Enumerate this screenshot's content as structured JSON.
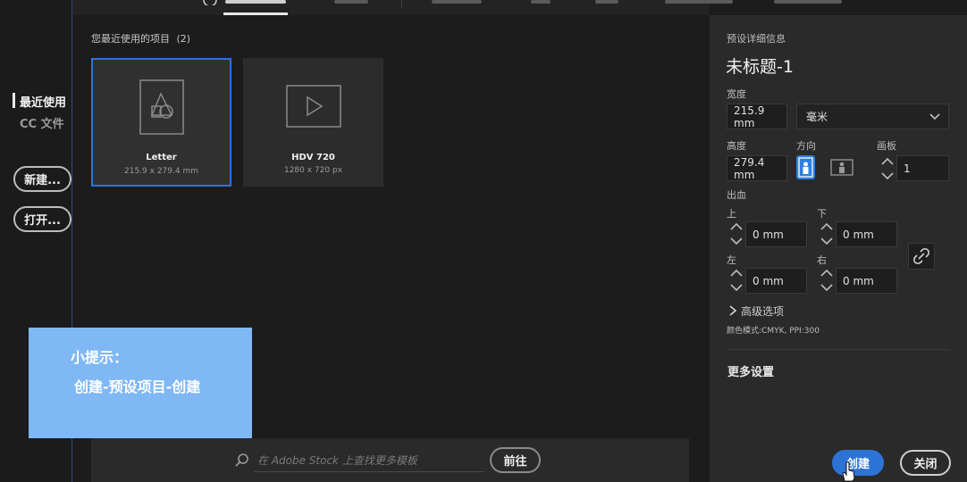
{
  "nav": {
    "recent": "最近使用",
    "cc_files": "CC 文件",
    "new_button": "新建...",
    "open_button": "打开..."
  },
  "recent": {
    "title": "您最近使用的项目",
    "count": "(2)",
    "presets": [
      {
        "name": "Letter",
        "size": "215.9 x 279.4 mm"
      },
      {
        "name": "HDV 720",
        "size": "1280 x 720 px"
      }
    ]
  },
  "search": {
    "placeholder": "在 Adobe Stock 上查找更多模板",
    "go_button": "前往"
  },
  "tip": {
    "line1": "小提示：",
    "line2": "创建-预设项目-创建"
  },
  "details": {
    "header": "预设详细信息",
    "doc_name": "未标题-1",
    "width_label": "宽度",
    "width_value": "215.9 mm",
    "unit": "毫米",
    "height_label": "高度",
    "height_value": "279.4 mm",
    "orientation_label": "方向",
    "artboards_label": "画板",
    "artboards_value": "1",
    "bleed_label": "出血",
    "bleed_top_label": "上",
    "bleed_top": "0 mm",
    "bleed_bottom_label": "下",
    "bleed_bottom": "0 mm",
    "bleed_left_label": "左",
    "bleed_left": "0 mm",
    "bleed_right_label": "右",
    "bleed_right": "0 mm",
    "advanced": "高级选项",
    "color_mode": "颜色模式:CMYK, PPI:300",
    "more_settings": "更多设置"
  },
  "actions": {
    "create": "创建",
    "close": "关闭"
  },
  "colors": {
    "accent": "#2d73d6",
    "tip_background": "#7fb8f5"
  }
}
